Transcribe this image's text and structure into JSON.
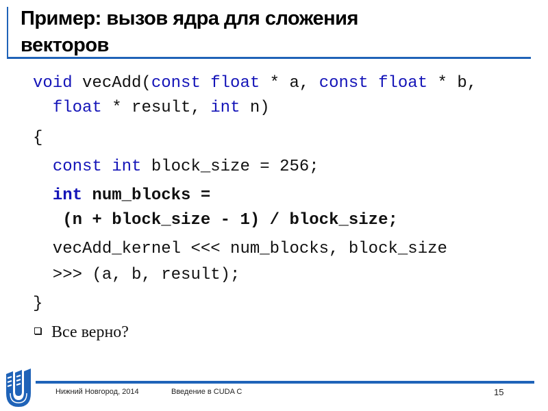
{
  "slide": {
    "title_line1": "Пример: вызов ядра для сложения",
    "title_line2": "векторов",
    "code_lines": [
      [
        {
          "t": "void",
          "k": "kw"
        },
        {
          "t": " vecAdd("
        },
        {
          "t": "const float",
          "k": "kw"
        },
        {
          "t": " * a, "
        },
        {
          "t": "const float",
          "k": "kw"
        },
        {
          "t": " * b,"
        }
      ],
      [
        {
          "t": "  "
        },
        {
          "t": "float",
          "k": "kw"
        },
        {
          "t": " * result, "
        },
        {
          "t": "int",
          "k": "kw"
        },
        {
          "t": " n)"
        }
      ],
      [
        {
          "t": "{"
        }
      ],
      [
        {
          "t": "  "
        },
        {
          "t": "const int",
          "k": "kw"
        },
        {
          "t": " block_size = 256;"
        }
      ],
      [
        {
          "t": "  "
        },
        {
          "t": "int",
          "k": "kw bold"
        },
        {
          "t": " num_blocks =",
          "k": "bold"
        }
      ],
      [
        {
          "t": "   (n + block_size - 1) / block_size;",
          "k": "bold"
        }
      ],
      [
        {
          "t": "  vecAdd_kernel <<< num_blocks, block_size"
        }
      ],
      [
        {
          "t": "  >>> (a, b, result);"
        }
      ],
      [
        {
          "t": "}"
        }
      ]
    ],
    "bullet_text": "Все верно?"
  },
  "footer": {
    "location_year": "Нижний Новгород, 2014",
    "course": "Введение в CUDA C",
    "page_number": "15",
    "logo_icon": "unn-logo-icon"
  },
  "colors": {
    "accent": "#1f63b8",
    "keyword": "#1414b8"
  }
}
